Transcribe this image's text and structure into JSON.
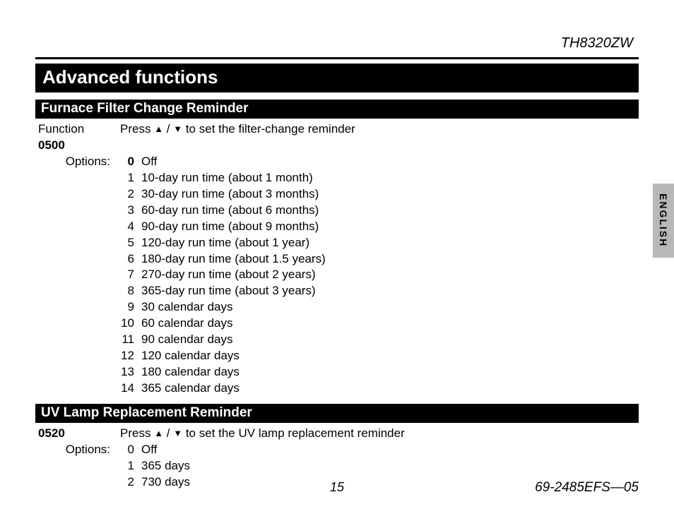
{
  "header": {
    "model": "TH8320ZW"
  },
  "title": "Advanced functions",
  "tab": "ENGLISH",
  "sections": [
    {
      "heading": "Furnace Filter Change Reminder",
      "func_label": "Function",
      "func_number": "0500",
      "options_label": "Options:",
      "instruction_pre": "Press ",
      "instruction_mid": " / ",
      "instruction_post": " to set the filter-change reminder",
      "options": [
        {
          "n": "0",
          "bold": true,
          "t": "Off"
        },
        {
          "n": "1",
          "t": "10-day run time (about 1 month)"
        },
        {
          "n": "2",
          "t": "30-day run time (about 3 months)"
        },
        {
          "n": "3",
          "t": "60-day run time (about 6 months)"
        },
        {
          "n": "4",
          "t": "90-day run time (about 9 months)"
        },
        {
          "n": "5",
          "t": "120-day run time (about 1 year)"
        },
        {
          "n": "6",
          "t": "180-day run time (about 1.5 years)"
        },
        {
          "n": "7",
          "t": "270-day run time (about 2 years)"
        },
        {
          "n": "8",
          "t": "365-day run time (about 3 years)"
        },
        {
          "n": "9",
          "t": "30 calendar days"
        },
        {
          "n": "10",
          "t": "60 calendar days"
        },
        {
          "n": "11",
          "t": "90 calendar days"
        },
        {
          "n": "12",
          "t": "120 calendar days"
        },
        {
          "n": "13",
          "t": "180 calendar days"
        },
        {
          "n": "14",
          "t": "365 calendar days"
        }
      ]
    },
    {
      "heading": "UV Lamp Replacement Reminder",
      "func_number": "0520",
      "options_label": "Options:",
      "instruction_pre": "Press ",
      "instruction_mid": " / ",
      "instruction_post": " to set the UV lamp replacement reminder",
      "options": [
        {
          "n": "0",
          "t": "Off"
        },
        {
          "n": "1",
          "t": "365 days"
        },
        {
          "n": "2",
          "t": "730 days"
        }
      ]
    }
  ],
  "footer": {
    "page": "15",
    "doc": "69-2485EFS—05"
  }
}
